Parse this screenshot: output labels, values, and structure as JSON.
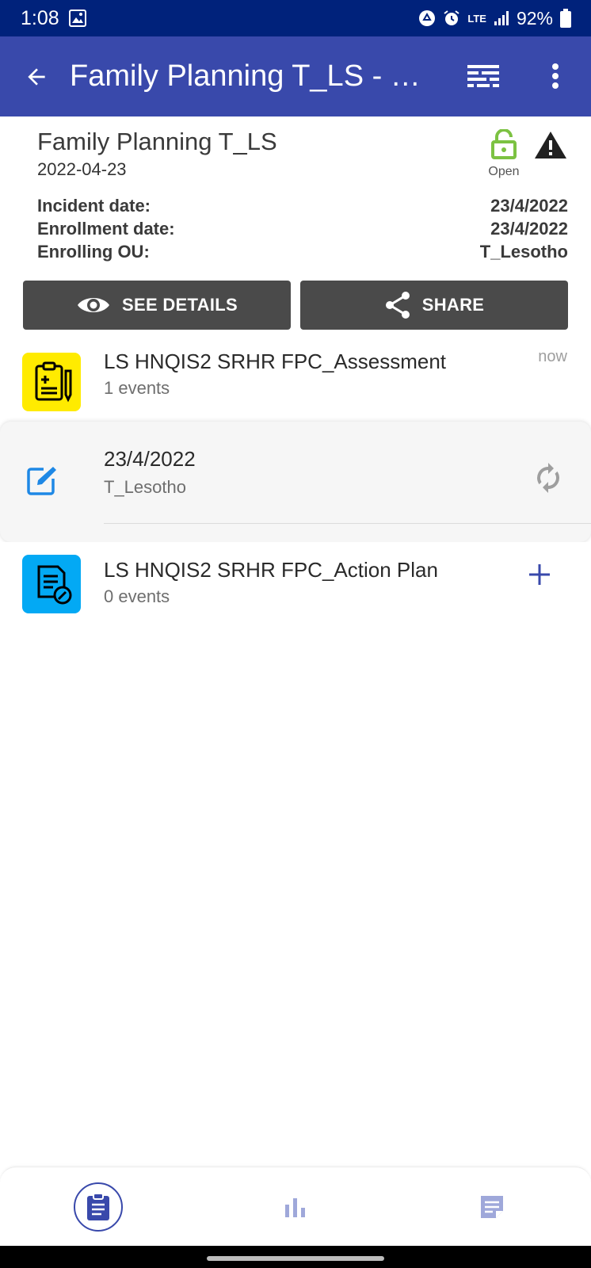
{
  "status_bar": {
    "time": "1:08",
    "network": "LTE",
    "battery": "92%"
  },
  "app_bar": {
    "title": "Family Planning T_LS - …",
    "background": "#3949ab"
  },
  "enrollment": {
    "program_name": "Family Planning T_LS",
    "program_date": "2022-04-23",
    "status_label": "Open",
    "status_color": "#7cc242",
    "incident_label": "Incident date:",
    "incident_value": "23/4/2022",
    "enrollment_label": "Enrollment date:",
    "enrollment_value": "23/4/2022",
    "ou_label": "Enrolling OU:",
    "ou_value": "T_Lesotho",
    "see_details_label": "SEE DETAILS",
    "share_label": "SHARE"
  },
  "stages": [
    {
      "title": "LS HNQIS2 SRHR FPC_Assessment",
      "count": "1 events",
      "time": "now",
      "icon": "clipboard-icon",
      "icon_bg": "#ffeb00"
    },
    {
      "title": "LS HNQIS2 SRHR FPC_Action Plan",
      "count": "0 events",
      "icon": "document-edit-icon",
      "icon_bg": "#03a9f4"
    }
  ],
  "event": {
    "date": "23/4/2022",
    "org_unit": "T_Lesotho"
  },
  "bottom_nav": {
    "items": [
      "events-icon",
      "analytics-icon",
      "notes-icon"
    ],
    "accent": "#3949ab",
    "inactive": "#9fa8da"
  }
}
